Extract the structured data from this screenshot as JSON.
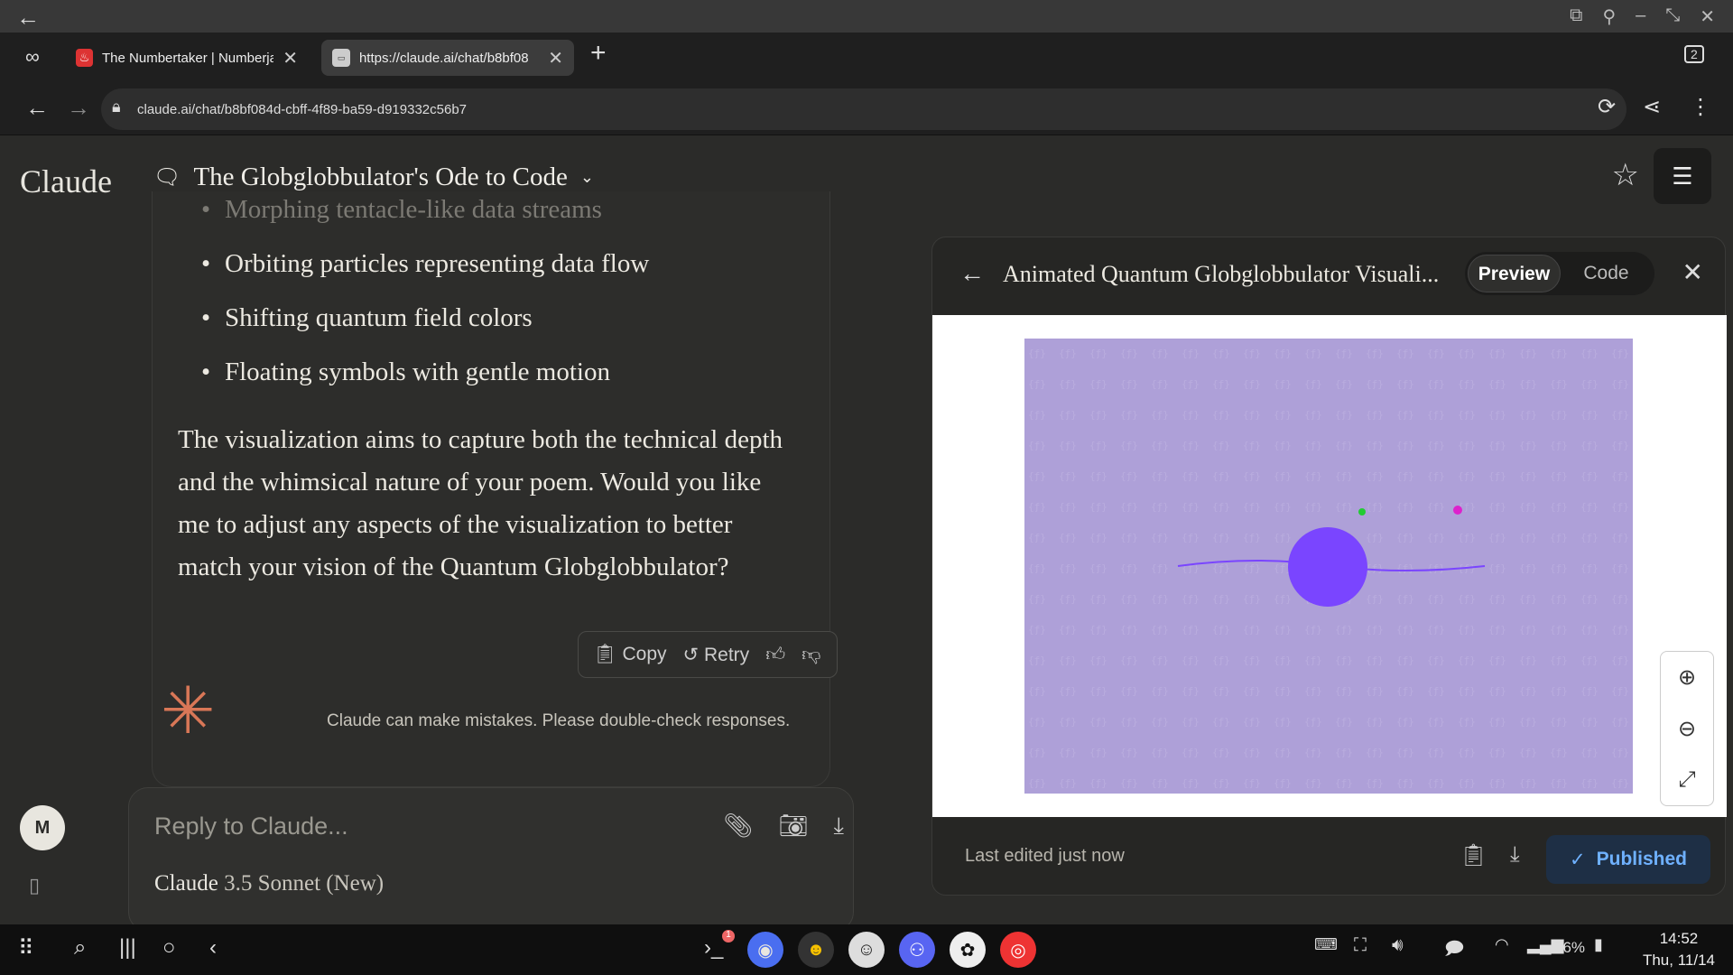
{
  "browser": {
    "tabs": [
      {
        "title": "The Numbertaker | Numberja",
        "favicon": "flame-icon"
      },
      {
        "title": "https://claude.ai/chat/b8bf08",
        "favicon": "claude-favicon"
      }
    ],
    "new_tab_label": "+",
    "tab_count": "2",
    "url": "claude.ai/chat/b8bf084d-cbff-4f89-ba59-d919332c56b7"
  },
  "app": {
    "logo": "Claude",
    "conversation_title": "The Globglobbulator's Ode to Code"
  },
  "message": {
    "bullets": [
      "Morphing tentacle-like data streams",
      "Orbiting particles representing data flow",
      "Shifting quantum field colors",
      "Floating symbols with gentle motion"
    ],
    "paragraph": "The visualization aims to capture both the technical depth and the whimsical nature of your poem. Would you like me to adjust any aspects of the visualization to better match your vision of the Quantum Globglobbulator?",
    "actions": {
      "copy": "Copy",
      "retry": "Retry"
    }
  },
  "disclaimer": "Claude can make mistakes. Please double-check responses.",
  "user_avatar": "M",
  "composer": {
    "placeholder": "Reply to Claude...",
    "model_brand": "Claude",
    "model_version": "3.5 Sonnet (New)"
  },
  "artifact": {
    "title": "Animated Quantum Globglobbulator Visuali...",
    "tab_preview": "Preview",
    "tab_code": "Code",
    "active_tab": "Preview",
    "last_edited": "Last edited just now",
    "publish_label": "Published",
    "viz_colors": {
      "background": "#aea0d8",
      "orb": "#7a45ff",
      "particle_green": "#22cc33",
      "particle_magenta": "#dd22cc"
    }
  },
  "taskbar": {
    "battery": "76%",
    "time": "14:52",
    "date": "Thu, 11/14",
    "terminal_badge": "1"
  }
}
